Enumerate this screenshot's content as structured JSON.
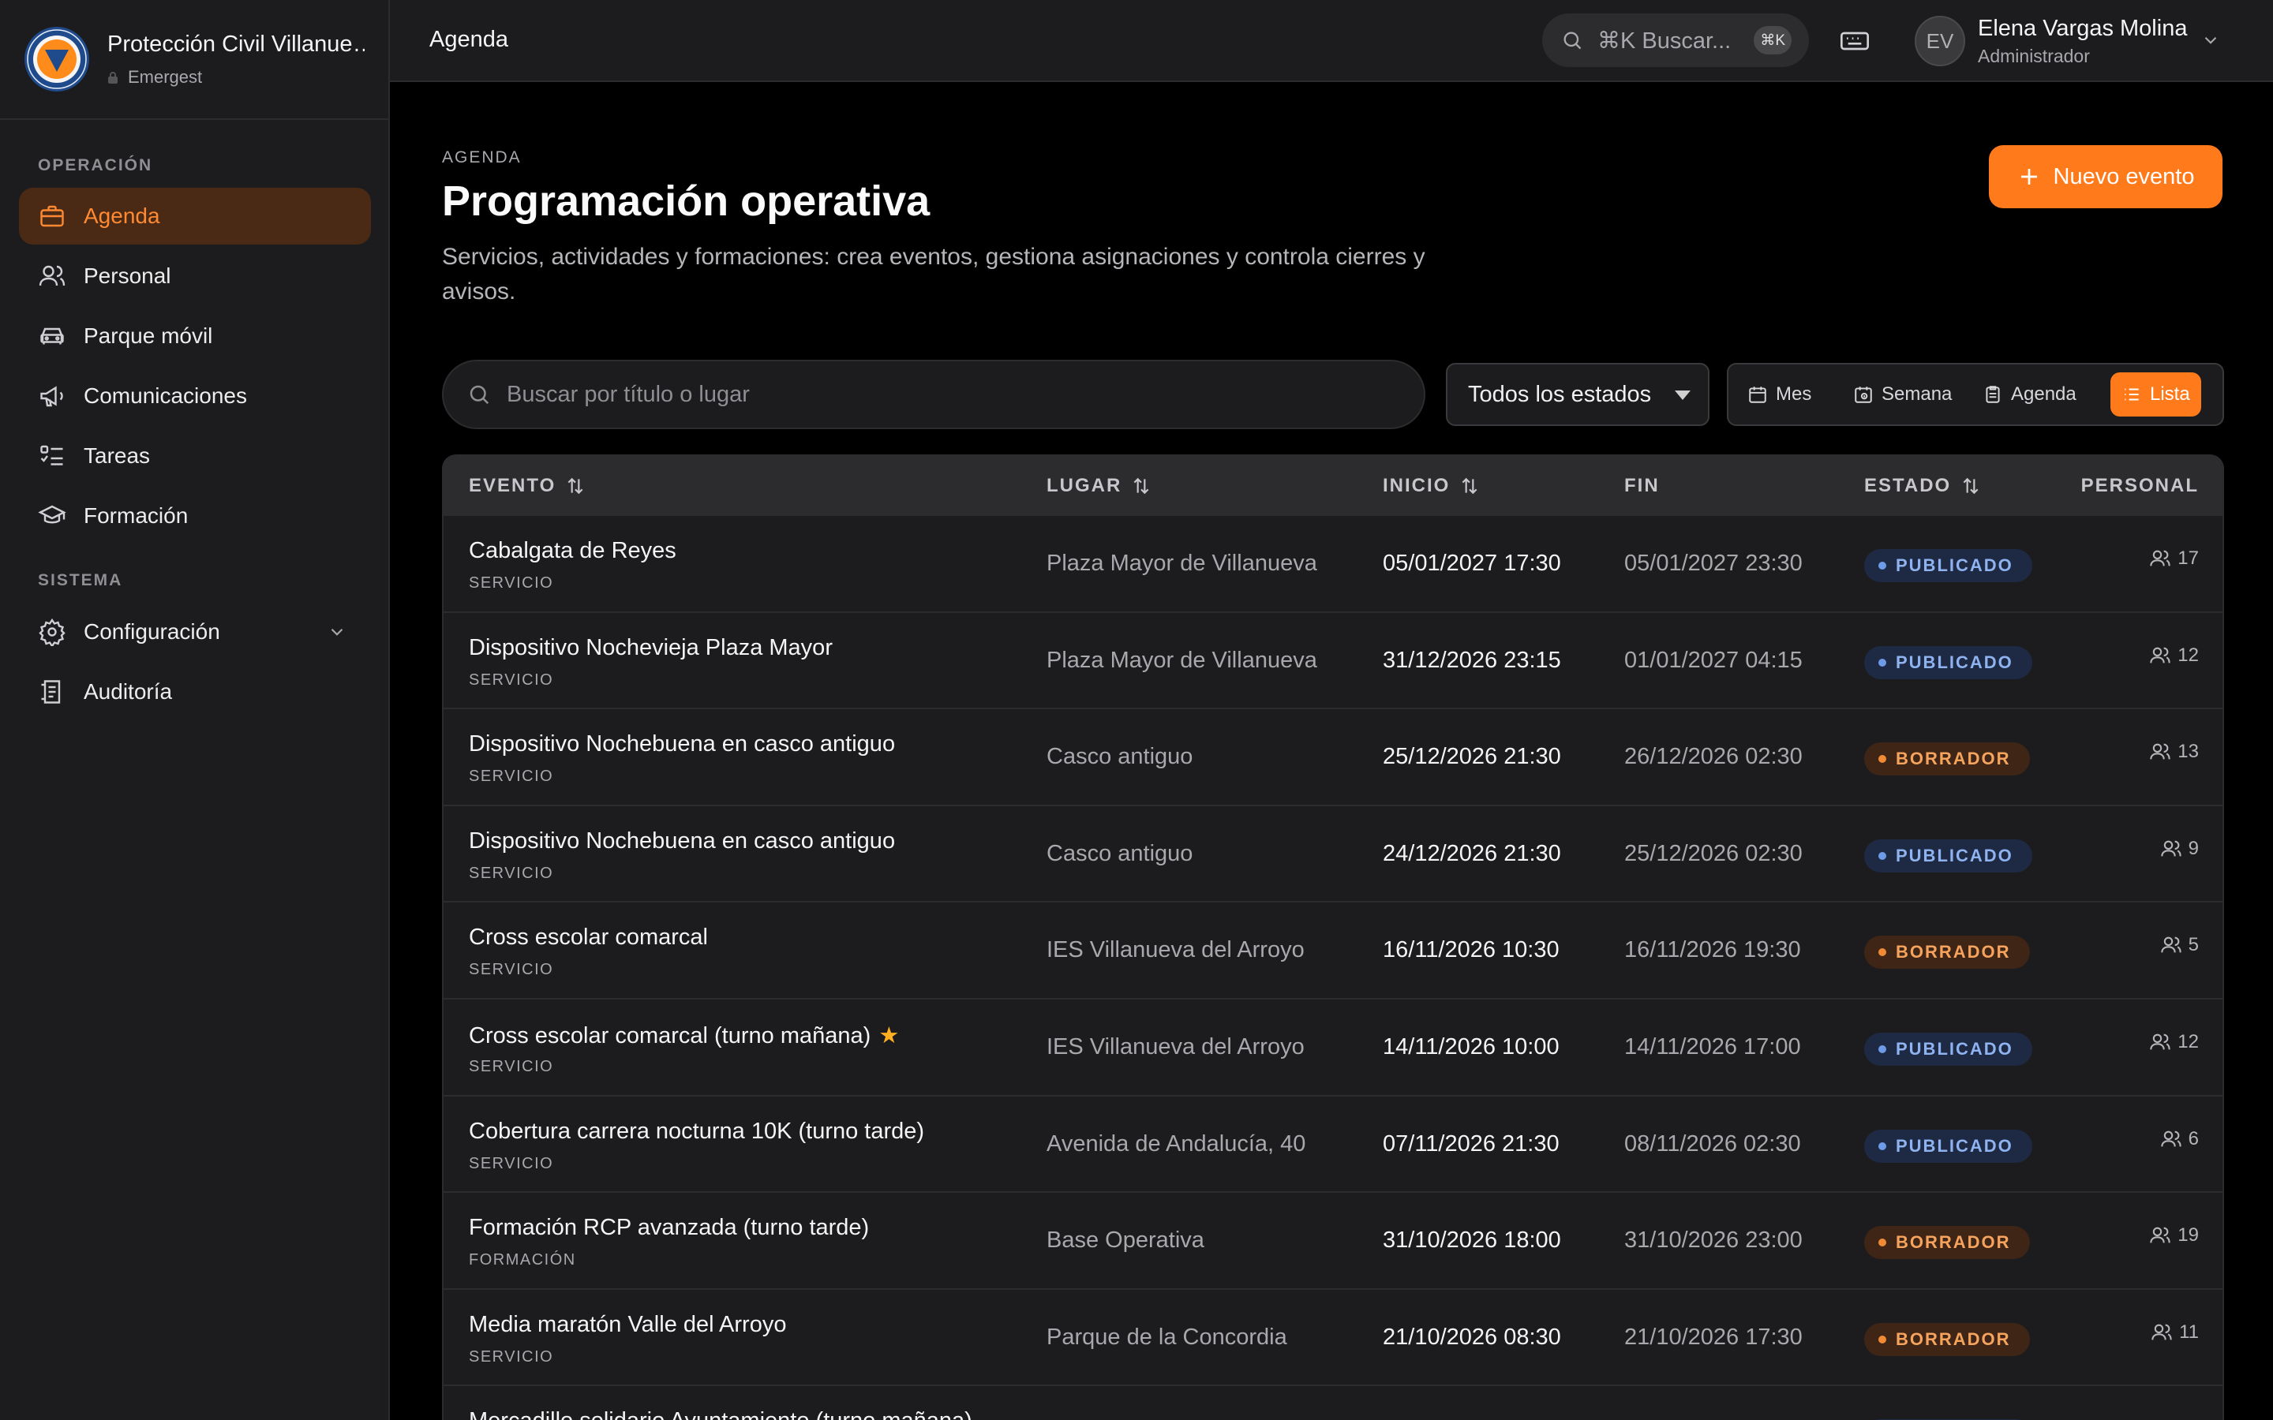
{
  "brand": {
    "name": "Protección Civil Villanueva del Arroyo",
    "subtitle": "Emergest"
  },
  "sidebar": {
    "sections": [
      "OPERACIÓN",
      "SISTEMA"
    ],
    "items": [
      {
        "label": "Agenda",
        "icon": "briefcase-icon",
        "active": true
      },
      {
        "label": "Personal",
        "icon": "users-icon"
      },
      {
        "label": "Parque móvil",
        "icon": "car-icon"
      },
      {
        "label": "Comunicaciones",
        "icon": "megaphone-icon"
      },
      {
        "label": "Tareas",
        "icon": "checklist-icon"
      },
      {
        "label": "Formación",
        "icon": "graduation-cap-icon"
      },
      {
        "label": "Configuración",
        "icon": "gear-icon",
        "expandable": true
      },
      {
        "label": "Auditoría",
        "icon": "audit-log-icon"
      }
    ]
  },
  "topbar": {
    "breadcrumb": "Agenda",
    "search_placeholder": "⌘K Buscar...",
    "shortcut": "⌘K",
    "user": {
      "initials": "EV",
      "name": "Elena Vargas Molina",
      "role": "Administrador"
    }
  },
  "page": {
    "eyebrow": "AGENDA",
    "title": "Programación operativa",
    "description": "Servicios, actividades y formaciones: crea eventos, gestiona asignaciones y controla cierres y avisos.",
    "new_button": "Nuevo evento"
  },
  "filters": {
    "search_placeholder": "Buscar por título o lugar",
    "status_select": "Todos los estados",
    "views": [
      {
        "label": "Mes",
        "icon": "calendar-icon"
      },
      {
        "label": "Semana",
        "icon": "calendar-week-icon"
      },
      {
        "label": "Agenda",
        "icon": "clipboard-icon"
      },
      {
        "label": "Lista",
        "icon": "list-icon",
        "active": true
      }
    ]
  },
  "table": {
    "columns": [
      "EVENTO",
      "LUGAR",
      "INICIO",
      "FIN",
      "ESTADO",
      "PERSONAL"
    ],
    "rows": [
      {
        "title": "Cabalgata de Reyes",
        "type": "SERVICIO",
        "place": "Plaza Mayor de Villanueva",
        "start": "05/01/2027 17:30",
        "end": "05/01/2027 23:30",
        "status": "PUBLICADO",
        "staff": "17"
      },
      {
        "title": "Dispositivo Nochevieja Plaza Mayor",
        "type": "SERVICIO",
        "place": "Plaza Mayor de Villanueva",
        "start": "31/12/2026 23:15",
        "end": "01/01/2027 04:15",
        "status": "PUBLICADO",
        "staff": "12"
      },
      {
        "title": "Dispositivo Nochebuena en casco antiguo",
        "type": "SERVICIO",
        "place": "Casco antiguo",
        "start": "25/12/2026 21:30",
        "end": "26/12/2026 02:30",
        "status": "BORRADOR",
        "staff": "13"
      },
      {
        "title": "Dispositivo Nochebuena en casco antiguo",
        "type": "SERVICIO",
        "place": "Casco antiguo",
        "start": "24/12/2026 21:30",
        "end": "25/12/2026 02:30",
        "status": "PUBLICADO",
        "staff": "9"
      },
      {
        "title": "Cross escolar comarcal",
        "type": "SERVICIO",
        "place": "IES Villanueva del Arroyo",
        "start": "16/11/2026 10:30",
        "end": "16/11/2026 19:30",
        "status": "BORRADOR",
        "staff": "5"
      },
      {
        "title": "Cross escolar comarcal (turno mañana)",
        "type": "SERVICIO",
        "place": "IES Villanueva del Arroyo",
        "start": "14/11/2026 10:00",
        "end": "14/11/2026 17:00",
        "status": "PUBLICADO",
        "staff": "12",
        "starred": true
      },
      {
        "title": "Cobertura carrera nocturna 10K (turno tarde)",
        "type": "SERVICIO",
        "place": "Avenida de Andalucía, 40",
        "start": "07/11/2026 21:30",
        "end": "08/11/2026 02:30",
        "status": "PUBLICADO",
        "staff": "6"
      },
      {
        "title": "Formación RCP avanzada (turno tarde)",
        "type": "FORMACIÓN",
        "place": "Base Operativa",
        "start": "31/10/2026 18:00",
        "end": "31/10/2026 23:00",
        "status": "BORRADOR",
        "staff": "19"
      },
      {
        "title": "Media maratón Valle del Arroyo",
        "type": "SERVICIO",
        "place": "Parque de la Concordia",
        "start": "21/10/2026 08:30",
        "end": "21/10/2026 17:30",
        "status": "BORRADOR",
        "staff": "11"
      },
      {
        "title": "Mercadillo solidario Ayuntamiento (turno mañana)",
        "type": "",
        "place": "",
        "start": "",
        "end": "",
        "status": "PUBLICADO",
        "staff": ""
      }
    ]
  },
  "colors": {
    "accent": "#ff7a1a",
    "published": "#8fb3f0",
    "draft": "#f6a35d"
  }
}
